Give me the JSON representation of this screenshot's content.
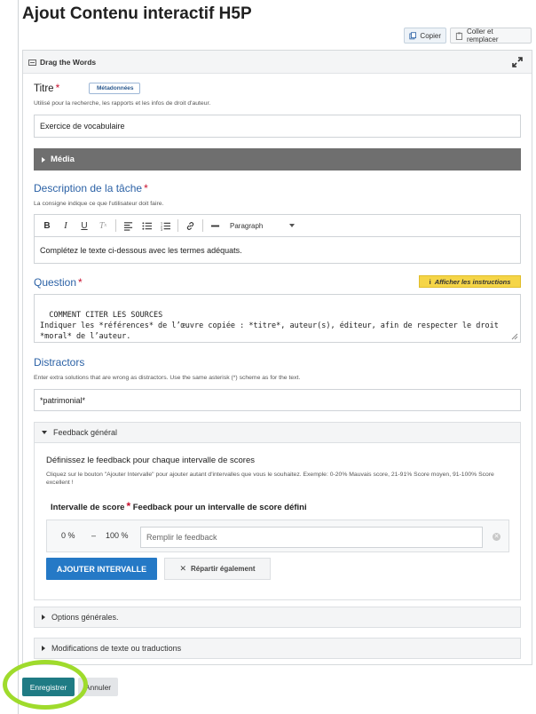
{
  "page": {
    "title": "Ajout Contenu interactif H5P",
    "copy_label": "Copier",
    "paste_label": "Coller et remplacer"
  },
  "editor": {
    "library_name": "Drag the Words"
  },
  "title_field": {
    "label": "Titre",
    "required_mark": "*",
    "metadata_label": "Métadonnées",
    "description": "Utilisé pour la recherche, les rapports et les infos de droit d'auteur.",
    "value": "Exercice de vocabulaire"
  },
  "media": {
    "label": "Média"
  },
  "task_description": {
    "label": "Description de la tâche",
    "required_mark": "*",
    "description": "La consigne indique ce que l'utilisateur doit faire.",
    "format_label": "Paragraph",
    "value": "Complétez le texte ci-dessous avec les termes adéquats."
  },
  "question": {
    "label": "Question",
    "required_mark": "*",
    "instructions_label": "Afficher les instructions",
    "value": "COMMENT CITER LES SOURCES\nIndiquer les *références* de l’œuvre copiée : *titre*, auteur(s), éditeur, afin de respecter le droit *moral* de l’auteur."
  },
  "distractors": {
    "label": "Distractors",
    "description": "Enter extra solutions that are wrong as distractors. Use the same asterisk (*) scheme as for the text.",
    "value": "*patrimonial*"
  },
  "feedback": {
    "group_label": "Feedback général",
    "heading": "Définissez le feedback pour chaque intervalle de scores",
    "description": "Cliquez sur le bouton \"Ajouter Intervalle\" pour ajouter autant d'intervalles que vous le souhaitez. Exemple: 0-20% Mauvais score, 21-91% Score moyen, 91-100% Score excellent !",
    "col_range": "Intervalle de score",
    "required_mark": "*",
    "col_feedback": "Feedback pour un intervalle de score défini",
    "range_from": "0 %",
    "range_dash": "–",
    "range_to": "100 %",
    "feedback_placeholder": "Remplir le feedback",
    "add_label": "AJOUTER INTERVALLE",
    "split_label": "Répartir également"
  },
  "options_group": {
    "label": "Options générales."
  },
  "text_group": {
    "label": "Modifications de texte ou traductions"
  },
  "footer": {
    "save_label": "Enregistrer",
    "cancel_label": "Annuler"
  },
  "colors": {
    "primary": "#2579c6",
    "save": "#1f7b84",
    "highlight": "#9fdb2c",
    "instructions": "#f5d547",
    "required": "#c8102e"
  }
}
